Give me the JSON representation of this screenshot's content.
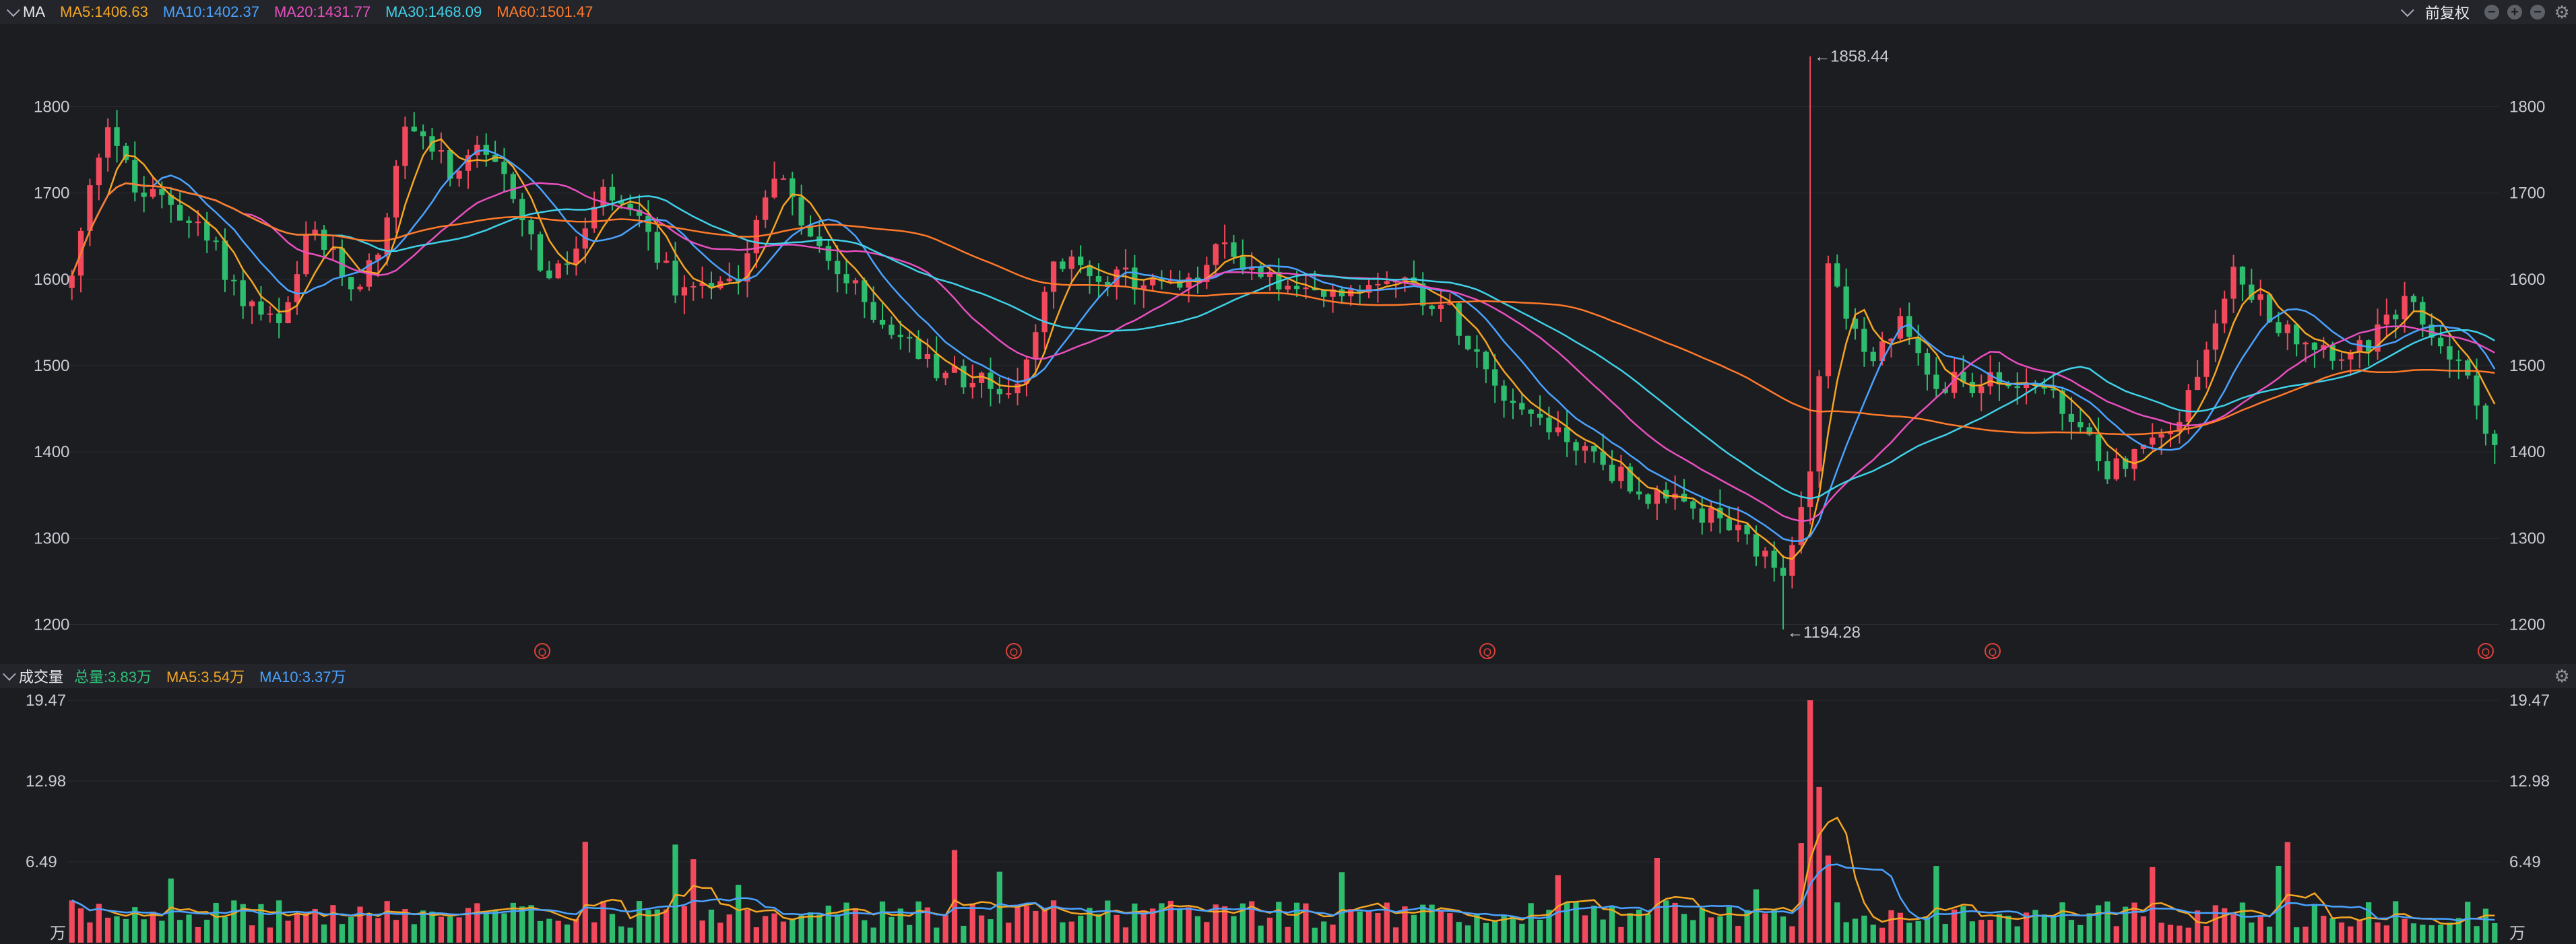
{
  "top_bar": {
    "indicator": "MA",
    "ma_items": [
      {
        "label": "MA5:1406.63",
        "color": "#f5a623"
      },
      {
        "label": "MA10:1402.37",
        "color": "#4aa3ff"
      },
      {
        "label": "MA20:1431.77",
        "color": "#e84fbf"
      },
      {
        "label": "MA30:1468.09",
        "color": "#3fd1e8"
      },
      {
        "label": "MA60:1501.47",
        "color": "#ff7a2a"
      }
    ],
    "adjust_label": "前复权"
  },
  "volume_bar": {
    "title": "成交量",
    "total": {
      "label": "总量:3.83万",
      "color": "#30c27a"
    },
    "ma5": {
      "label": "MA5:3.54万",
      "color": "#f5a623"
    },
    "ma10": {
      "label": "MA10:3.37万",
      "color": "#4aa3ff"
    }
  },
  "colors": {
    "up": "#f2495c",
    "down": "#2ebd6e",
    "grid": "#2a2c31",
    "marker": "#e0413b"
  },
  "chart_data": [
    {
      "type": "candlestick",
      "candles": 270,
      "ylim": [
        1170,
        1880
      ],
      "yticks": [
        1200,
        1300,
        1400,
        1500,
        1600,
        1700,
        1800
      ],
      "high_annotation": "1858.44",
      "low_annotation": "1194.28",
      "trend": [
        [
          0,
          1600
        ],
        [
          5,
          1700
        ],
        [
          10,
          1790
        ],
        [
          18,
          1700
        ],
        [
          28,
          1690
        ],
        [
          40,
          1640
        ],
        [
          48,
          1580
        ],
        [
          60,
          1540
        ],
        [
          68,
          1660
        ],
        [
          80,
          1590
        ],
        [
          87,
          1630
        ],
        [
          96,
          1790
        ],
        [
          110,
          1710
        ],
        [
          115,
          1750
        ],
        [
          126,
          1700
        ],
        [
          135,
          1600
        ],
        [
          140,
          1610
        ],
        [
          152,
          1700
        ],
        [
          164,
          1650
        ],
        [
          172,
          1590
        ],
        [
          190,
          1610
        ],
        [
          200,
          1730
        ],
        [
          211,
          1640
        ],
        [
          229,
          1560
        ],
        [
          245,
          1500
        ],
        [
          260,
          1480
        ],
        [
          270,
          1470
        ],
        [
          280,
          1620
        ],
        [
          300,
          1600
        ],
        [
          318,
          1590
        ],
        [
          328,
          1640
        ],
        [
          337,
          1610
        ],
        [
          350,
          1580
        ],
        [
          360,
          1580
        ],
        [
          375,
          1610
        ],
        [
          393,
          1560
        ],
        [
          410,
          1460
        ],
        [
          432,
          1400
        ],
        [
          448,
          1350
        ],
        [
          470,
          1320
        ],
        [
          488,
          1250
        ],
        [
          496,
          1410
        ],
        [
          500,
          1620
        ],
        [
          512,
          1490
        ],
        [
          520,
          1550
        ],
        [
          532,
          1480
        ],
        [
          540,
          1480
        ],
        [
          560,
          1480
        ],
        [
          580,
          1380
        ],
        [
          600,
          1430
        ],
        [
          615,
          1610
        ],
        [
          630,
          1540
        ],
        [
          650,
          1510
        ],
        [
          665,
          1570
        ],
        [
          680,
          1500
        ],
        [
          690,
          1410
        ]
      ],
      "ma_series": [
        {
          "name": "MA5",
          "color": "#f5a623",
          "window": 5
        },
        {
          "name": "MA10",
          "color": "#4aa3ff",
          "window": 10
        },
        {
          "name": "MA20",
          "color": "#e84fbf",
          "window": 20
        },
        {
          "name": "MA30",
          "color": "#3fd1e8",
          "window": 30
        },
        {
          "name": "MA60",
          "color": "#ff7a2a",
          "window": 60
        }
      ],
      "event_markers": [
        "Q",
        "Q",
        "Q",
        "Q",
        "Q"
      ]
    },
    {
      "type": "bar",
      "title": "成交量",
      "unit": "万",
      "ylim": [
        0,
        19.47
      ],
      "yticks": [
        "6.49",
        "12.98",
        "19.47"
      ],
      "peak": 19.47
    }
  ]
}
